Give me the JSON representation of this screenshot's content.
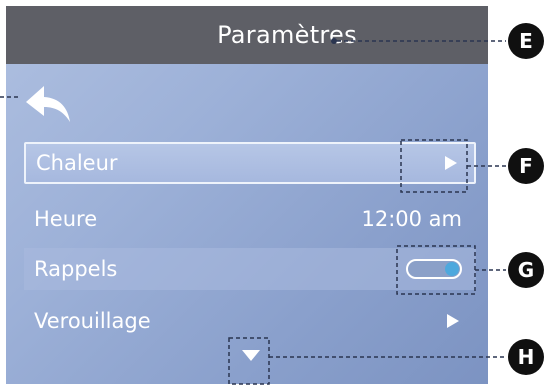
{
  "header": {
    "title": "Paramètres"
  },
  "menu": {
    "items": [
      {
        "label": "Chaleur",
        "control": "arrow",
        "value": ""
      },
      {
        "label": "Heure",
        "control": "value",
        "value": "12:00 am"
      },
      {
        "label": "Rappels",
        "control": "toggle",
        "value": "",
        "toggle_on": true
      },
      {
        "label": "Verouillage",
        "control": "arrow",
        "value": ""
      }
    ]
  },
  "callouts": {
    "e": "E",
    "f": "F",
    "g": "G",
    "h": "H"
  },
  "icons": {
    "back": "back-arrow-icon",
    "more": "scroll-down-icon",
    "item": "play-arrow-icon"
  },
  "colors": {
    "title_bar": "#5e5f66",
    "toggle_knob": "#4ea8dd",
    "callout": "#101010"
  }
}
